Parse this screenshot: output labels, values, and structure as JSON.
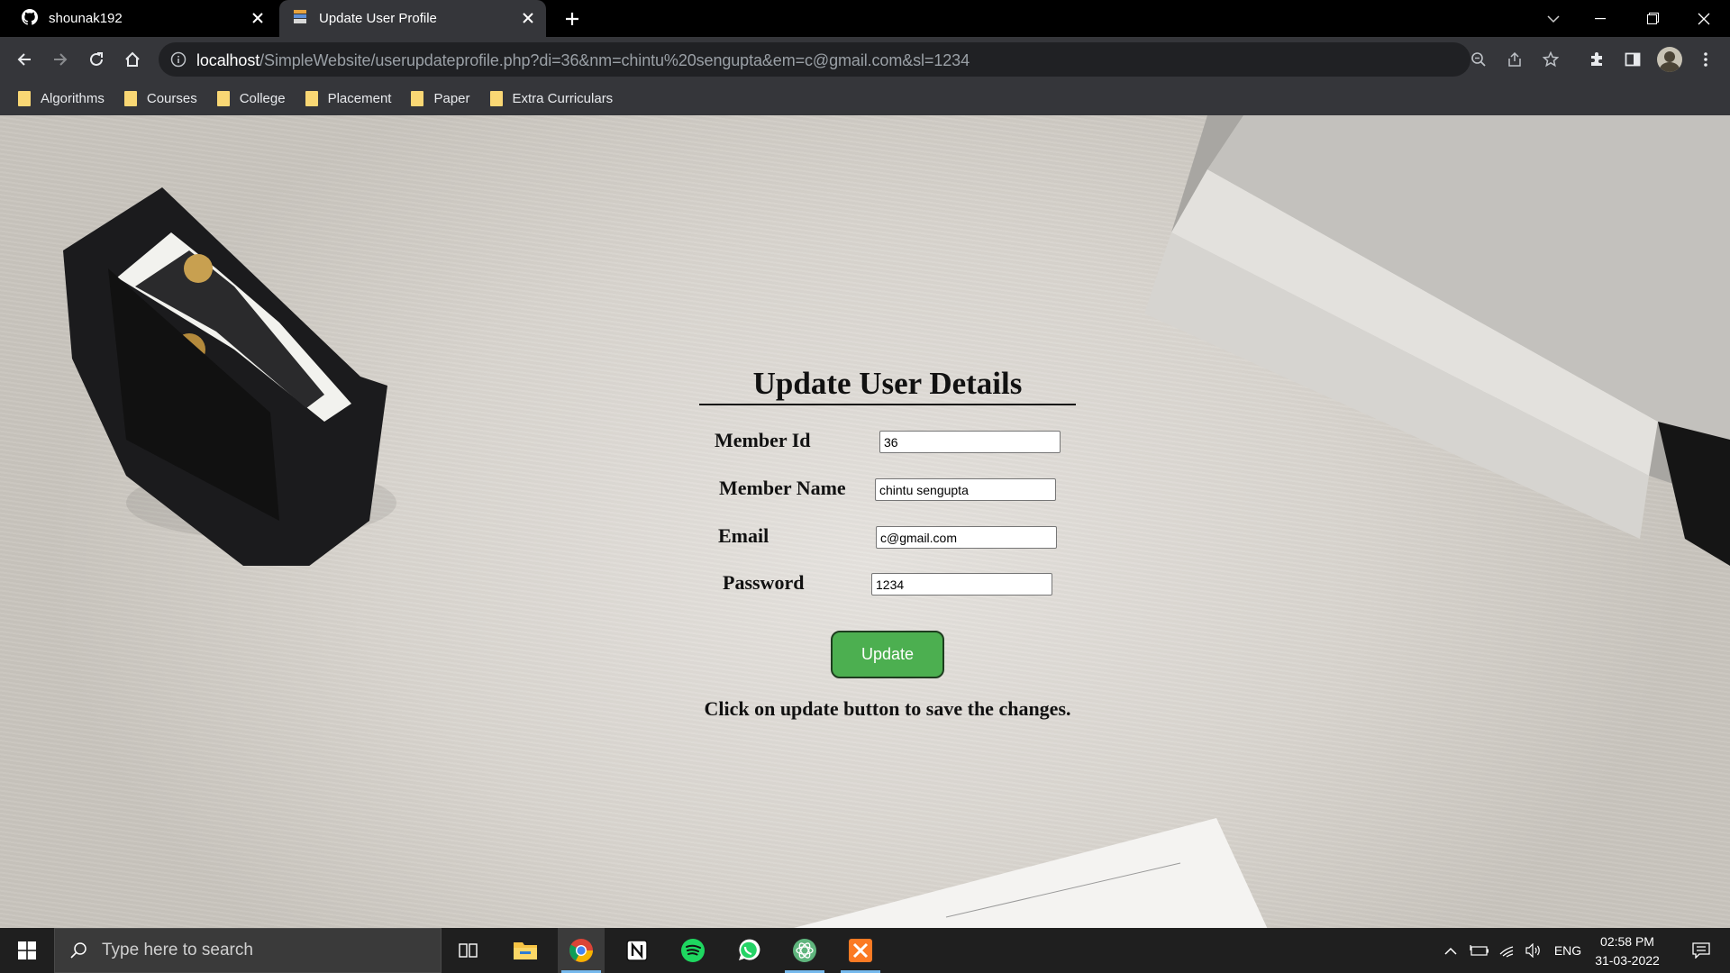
{
  "browser": {
    "tabs": [
      {
        "title": "shounak192",
        "icon": "github-icon",
        "active": false
      },
      {
        "title": "Update User Profile",
        "icon": "page-favicon",
        "active": true
      }
    ],
    "url_host": "localhost",
    "url_rest": "/SimpleWebsite/userupdateprofile.php?di=36&nm=chintu%20sengupta&em=c@gmail.com&sl=1234",
    "bookmarks": [
      "Algorithms",
      "Courses",
      "College",
      "Placement",
      "Paper",
      "Extra Curriculars"
    ]
  },
  "page": {
    "heading": "Update User Details",
    "fields": [
      {
        "label": "Member Id",
        "value": "36"
      },
      {
        "label": "Member Name",
        "value": "chintu sengupta"
      },
      {
        "label": "Email",
        "value": "c@gmail.com"
      },
      {
        "label": "Password",
        "value": "1234"
      }
    ],
    "button_label": "Update",
    "hint": "Click on update button to save the changes.",
    "button_color": "#4caf50"
  },
  "taskbar": {
    "search_placeholder": "Type here to search",
    "apps": [
      "task-view",
      "file-explorer",
      "chrome",
      "notion",
      "spotify",
      "whatsapp",
      "atom",
      "xampp"
    ],
    "language": "ENG",
    "time": "02:58 PM",
    "date": "31-03-2022"
  }
}
